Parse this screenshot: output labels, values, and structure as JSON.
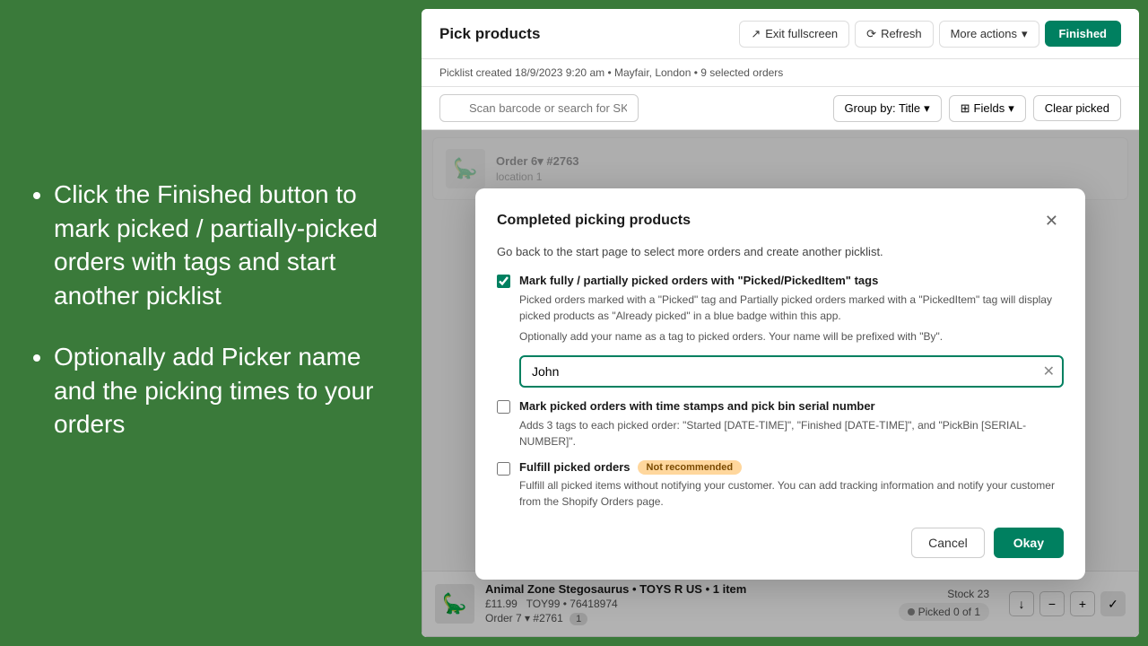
{
  "left": {
    "bullets": [
      "Click the Finished button to mark picked / partially-picked orders with tags and start another picklist",
      "Optionally add Picker name and the picking times to your orders"
    ]
  },
  "app": {
    "title": "Pick products",
    "header_buttons": {
      "exit_fullscreen": "Exit fullscreen",
      "refresh": "Refresh",
      "more_actions": "More actions",
      "finished": "Finished"
    },
    "sub_header": "Picklist created 18/9/2023 9:20 am • Mayfair, London • 9 selected orders",
    "toolbar": {
      "search_placeholder": "Scan barcode or search for SKU/title ...",
      "group_by": "Group by: Title",
      "fields": "Fields",
      "clear_picked": "Clear picked"
    },
    "product1": {
      "emoji": "🦕",
      "name": "Animal Zone Stegosaurus • TOYS R US • 1 item",
      "price": "£11.99",
      "sku": "TOY99 • 76418974",
      "order": "Order 7",
      "order_num": "#2761",
      "badge": "1",
      "stock": "Stock 23",
      "picked": "Picked 0 of 1"
    }
  },
  "modal": {
    "title": "Completed picking products",
    "desc": "Go back to the start page to select more orders and create another picklist.",
    "checkbox1_label": "Mark fully / partially picked orders with \"Picked/PickedItem\" tags",
    "checkbox1_sublabel": "Picked orders marked with a \"Picked\" tag and Partially picked orders marked with a \"PickedItem\" tag will display picked products as \"Already picked\" in a blue badge within this app.",
    "checkbox1_sublabel2": "Optionally add your name as a tag to picked orders. Your name will be prefixed with \"By\".",
    "name_placeholder": "John",
    "checkbox2_label": "Mark picked orders with time stamps and pick bin serial number",
    "checkbox2_sublabel": "Adds 3 tags to each picked order: \"Started [DATE-TIME]\", \"Finished [DATE-TIME]\", and \"PickBin [SERIAL-NUMBER]\".",
    "checkbox3_label": "Fulfill picked orders",
    "badge_not_recommended": "Not recommended",
    "checkbox3_sublabel": "Fulfill all picked items without notifying your customer. You can add tracking information and notify your customer from the Shopify Orders page.",
    "cancel_label": "Cancel",
    "okay_label": "Okay"
  }
}
